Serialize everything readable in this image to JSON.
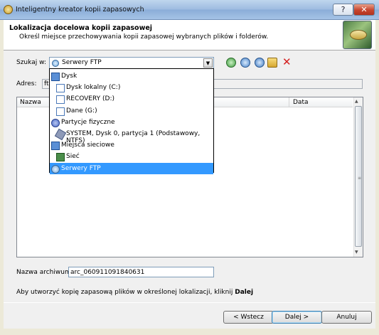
{
  "window": {
    "title": "Inteligentny kreator kopii zapasowych",
    "help_label": "?",
    "close_label": "✕"
  },
  "header": {
    "title": "Lokalizacja docelowa kopii zapasowej",
    "subtitle": "Określ miejsce przechowywania kopii zapasowej wybranych plików i folderów."
  },
  "location": {
    "label": "Szukaj w:",
    "selected": "Serwery FTP",
    "arrow": "▼"
  },
  "toolbar_icons": [
    "back-icon",
    "up-icon",
    "refresh-icon",
    "new-folder-icon",
    "delete-icon"
  ],
  "address": {
    "label": "Adres:",
    "value": "ftp"
  },
  "list": {
    "columns": [
      "Nazwa",
      "Data"
    ],
    "scroll_up": "▲",
    "scroll_down": "▼",
    "grip": "≡"
  },
  "archive": {
    "label": "Nazwa archiwum:",
    "value": "arc_060911091840631"
  },
  "hint": {
    "text": "Aby utworzyć kopię zapasową plików w określonej lokalizacji, kliknij ",
    "bold": "Dalej"
  },
  "buttons": {
    "back": "< Wstecz",
    "next": "Dalej >",
    "cancel": "Anuluj"
  },
  "dropdown": {
    "items": [
      {
        "label": "Dysk",
        "icon": "computer-icon",
        "level": 0,
        "selected": false
      },
      {
        "label": "Dysk lokalny (C:)",
        "icon": "drive-icon",
        "level": 1,
        "selected": false
      },
      {
        "label": "RECOVERY (D:)",
        "icon": "drive-icon",
        "level": 1,
        "selected": false
      },
      {
        "label": "Dane (G:)",
        "icon": "drive-icon",
        "level": 1,
        "selected": false
      },
      {
        "label": "Partycje fizyczne",
        "icon": "disk-icon",
        "level": 0,
        "selected": false
      },
      {
        "label": "SYSTEM, Dysk 0, partycja 1 (Podstawowy, NTFS)",
        "icon": "partition-icon",
        "level": 1,
        "selected": false
      },
      {
        "label": "Miejsca sieciowe",
        "icon": "network-places-icon",
        "level": 0,
        "selected": false
      },
      {
        "label": "Sieć",
        "icon": "network-icon",
        "level": 1,
        "selected": false
      },
      {
        "label": "Serwery FTP",
        "icon": "ftp-icon",
        "level": 0,
        "selected": true
      }
    ]
  },
  "colors": {
    "selection": "#3399ff",
    "title_bar": "#9dbbe0",
    "close_button": "#c6452e"
  }
}
